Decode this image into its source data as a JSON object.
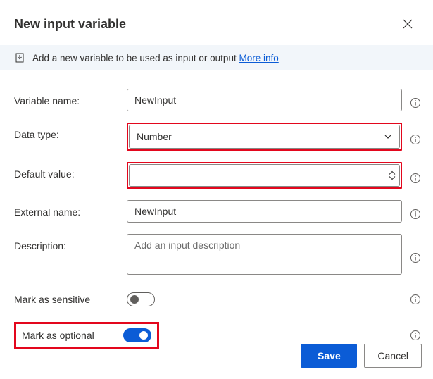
{
  "header": {
    "title": "New input variable"
  },
  "info_bar": {
    "text": "Add a new variable to be used as input or output",
    "link_text": "More info"
  },
  "form": {
    "variable_name": {
      "label": "Variable name:",
      "value": "NewInput"
    },
    "data_type": {
      "label": "Data type:",
      "value": "Number"
    },
    "default_value": {
      "label": "Default value:",
      "value": ""
    },
    "external_name": {
      "label": "External name:",
      "value": "NewInput"
    },
    "description": {
      "label": "Description:",
      "placeholder": "Add an input description",
      "value": ""
    },
    "mark_sensitive": {
      "label": "Mark as sensitive",
      "on": false
    },
    "mark_optional": {
      "label": "Mark as optional",
      "on": true
    }
  },
  "footer": {
    "save": "Save",
    "cancel": "Cancel"
  }
}
